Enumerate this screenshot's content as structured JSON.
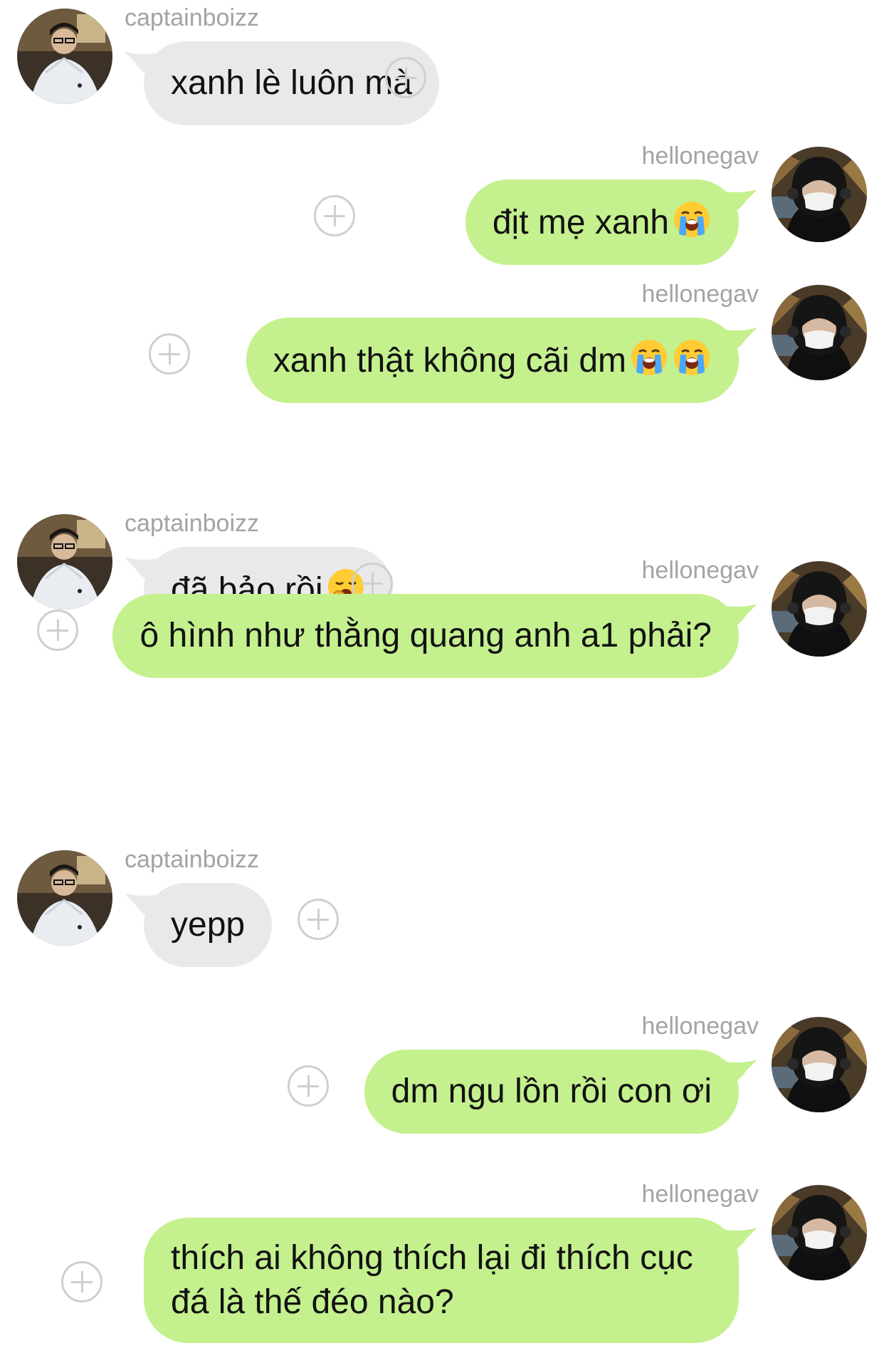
{
  "conversation": {
    "users": {
      "friend": "captainboizz",
      "me": "hellonegav"
    },
    "messages": [
      {
        "sender": "captainboizz",
        "text": "xanh lè luôn mà",
        "emojis": []
      },
      {
        "sender": "hellonegav",
        "text": "địt mẹ xanh",
        "emojis": [
          "loudly-crying-face"
        ]
      },
      {
        "sender": "hellonegav",
        "text": "xanh thật không cãi dm",
        "emojis": [
          "loudly-crying-face",
          "loudly-crying-face"
        ]
      },
      {
        "sender": "captainboizz",
        "text": "đã bảo rồi",
        "emojis": [
          "yawning-face"
        ]
      },
      {
        "sender": "hellonegav",
        "text": "ô hình như thằng quang anh a1 phải?",
        "emojis": []
      },
      {
        "sender": "captainboizz",
        "text": "yepp",
        "emojis": []
      },
      {
        "sender": "hellonegav",
        "text": "dm ngu lồn rồi con ơi",
        "emojis": []
      },
      {
        "sender": "hellonegav",
        "text": "thích ai không thích lại đi thích cục đá là thế đéo nào?",
        "emojis": []
      }
    ]
  },
  "colors": {
    "incoming_bubble": "#e9e9eb",
    "outgoing_bubble": "#c4f08e",
    "username": "#a3a3a3",
    "plus_icon": "#cfcfcf"
  },
  "icons": {
    "reaction_button": "plus-circle-icon",
    "avatar_friend": "avatar",
    "avatar_me": "avatar"
  }
}
